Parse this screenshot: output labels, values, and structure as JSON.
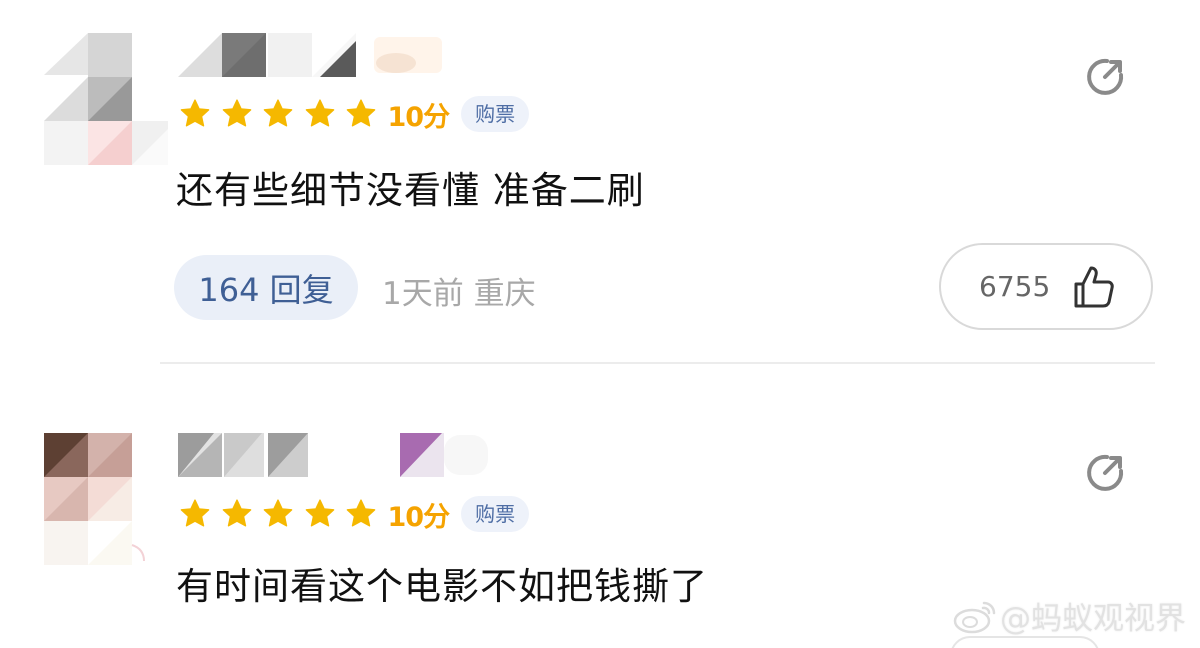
{
  "reviews": [
    {
      "score": "10分",
      "badge": "购票",
      "stars": 5,
      "comment": "还有些细节没看懂 准备二刷",
      "reply_label": "164 回复",
      "meta": "1天前  重庆",
      "likes": "6755"
    },
    {
      "score": "10分",
      "badge": "购票",
      "stars": 5,
      "comment": "有时间看这个电影不如把钱撕了"
    }
  ],
  "watermark": {
    "text": "@蚂蚁观视界"
  },
  "colors": {
    "star": "#f5b800",
    "score": "#f5a300",
    "badge_bg": "#eef2fa",
    "badge_text": "#4f6ea5",
    "reply_bg": "#eaeff8",
    "reply_text": "#3f5f95",
    "meta_text": "#a8a8a8"
  }
}
